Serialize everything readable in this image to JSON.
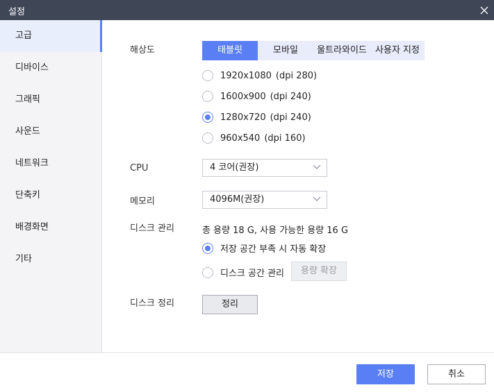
{
  "window": {
    "title": "설정"
  },
  "sidebar": {
    "items": [
      {
        "label": "고급",
        "active": true
      },
      {
        "label": "디바이스",
        "active": false
      },
      {
        "label": "그래픽",
        "active": false
      },
      {
        "label": "사운드",
        "active": false
      },
      {
        "label": "네트워크",
        "active": false
      },
      {
        "label": "단축키",
        "active": false
      },
      {
        "label": "배경화면",
        "active": false
      },
      {
        "label": "기타",
        "active": false
      }
    ]
  },
  "resolution": {
    "label": "해상도",
    "tabs": [
      "태블릿",
      "모바일",
      "울트라와이드",
      "사용자 지정"
    ],
    "active_tab": "태블릿",
    "options": [
      {
        "size": "1920x1080",
        "dpi": "(dpi 280)",
        "selected": false
      },
      {
        "size": "1600x900",
        "dpi": "(dpi 240)",
        "selected": false
      },
      {
        "size": "1280x720",
        "dpi": "(dpi 240)",
        "selected": true
      },
      {
        "size": "960x540",
        "dpi": "(dpi 160)",
        "selected": false
      }
    ]
  },
  "cpu": {
    "label": "CPU",
    "value": "4 코어(권장)"
  },
  "memory": {
    "label": "메모리",
    "value": "4096M(권장)"
  },
  "disk": {
    "label": "디스크 관리",
    "info": "총 용량 18 G,  사용 가능한 용량 16 G",
    "options": [
      {
        "label": "저장 공간 부족 시 자동 확장",
        "selected": true
      },
      {
        "label": "디스크 공간 관리",
        "selected": false
      }
    ],
    "expand_button": "용량 확장"
  },
  "cleanup": {
    "label": "디스크 정리",
    "button": "정리"
  },
  "footer": {
    "save": "저장",
    "cancel": "취소"
  },
  "colors": {
    "accent": "#5a7ff5",
    "titlebar": "#3f4656",
    "sidebar_bg": "#f4f4f6",
    "active_bg": "#e9eefc"
  }
}
